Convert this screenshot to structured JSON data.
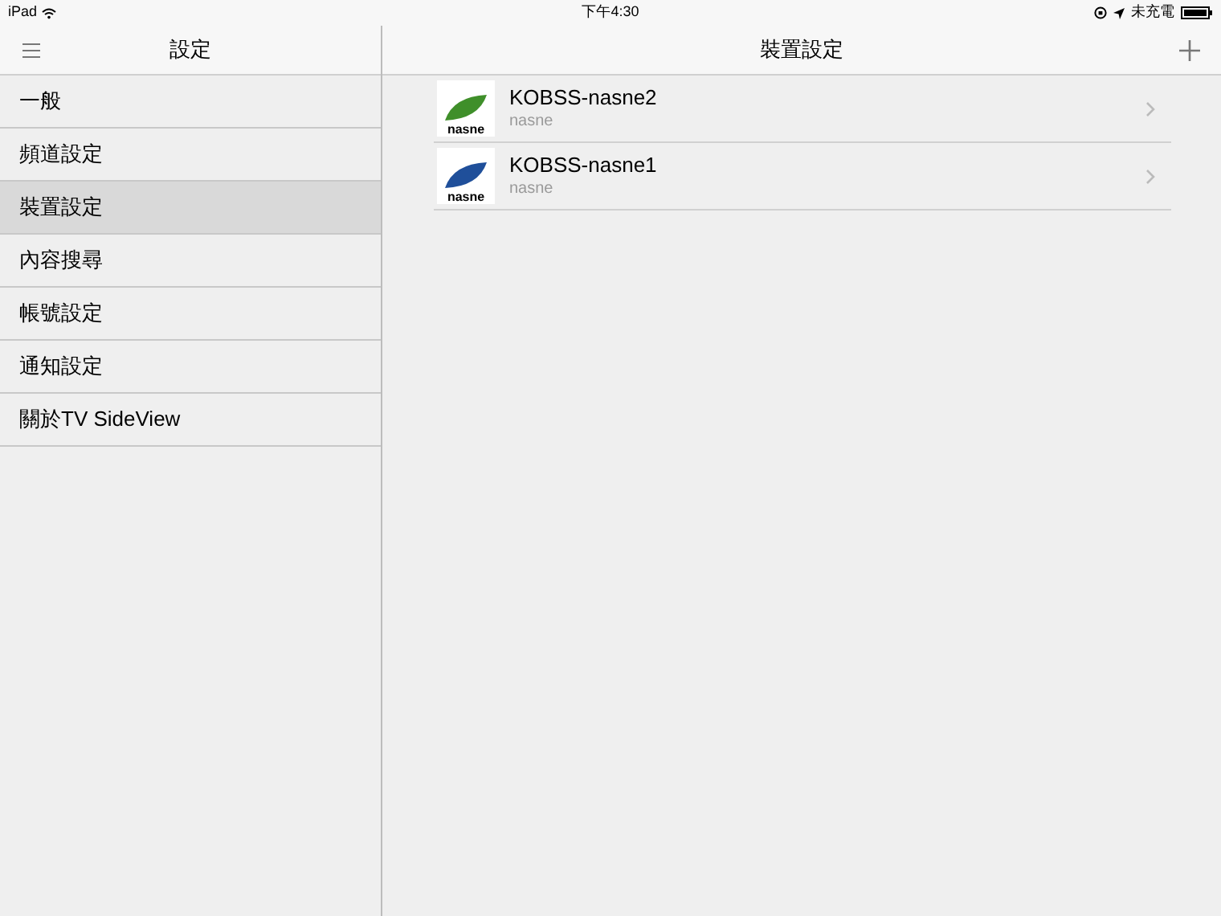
{
  "status_bar": {
    "device": "iPad",
    "time": "下午4:30",
    "charging": "未充電"
  },
  "sidebar": {
    "title": "設定",
    "items": [
      {
        "label": "一般",
        "selected": false
      },
      {
        "label": "頻道設定",
        "selected": false
      },
      {
        "label": "裝置設定",
        "selected": true
      },
      {
        "label": "內容搜尋",
        "selected": false
      },
      {
        "label": "帳號設定",
        "selected": false
      },
      {
        "label": "通知設定",
        "selected": false
      },
      {
        "label": "關於TV SideView",
        "selected": false
      }
    ]
  },
  "main": {
    "title": "裝置設定",
    "devices": [
      {
        "name": "KOBSS-nasne2",
        "type": "nasne",
        "logo_text": "nasne",
        "color": "#3f8f2a"
      },
      {
        "name": "KOBSS-nasne1",
        "type": "nasne",
        "logo_text": "nasne",
        "color": "#1f4f9a"
      }
    ]
  }
}
